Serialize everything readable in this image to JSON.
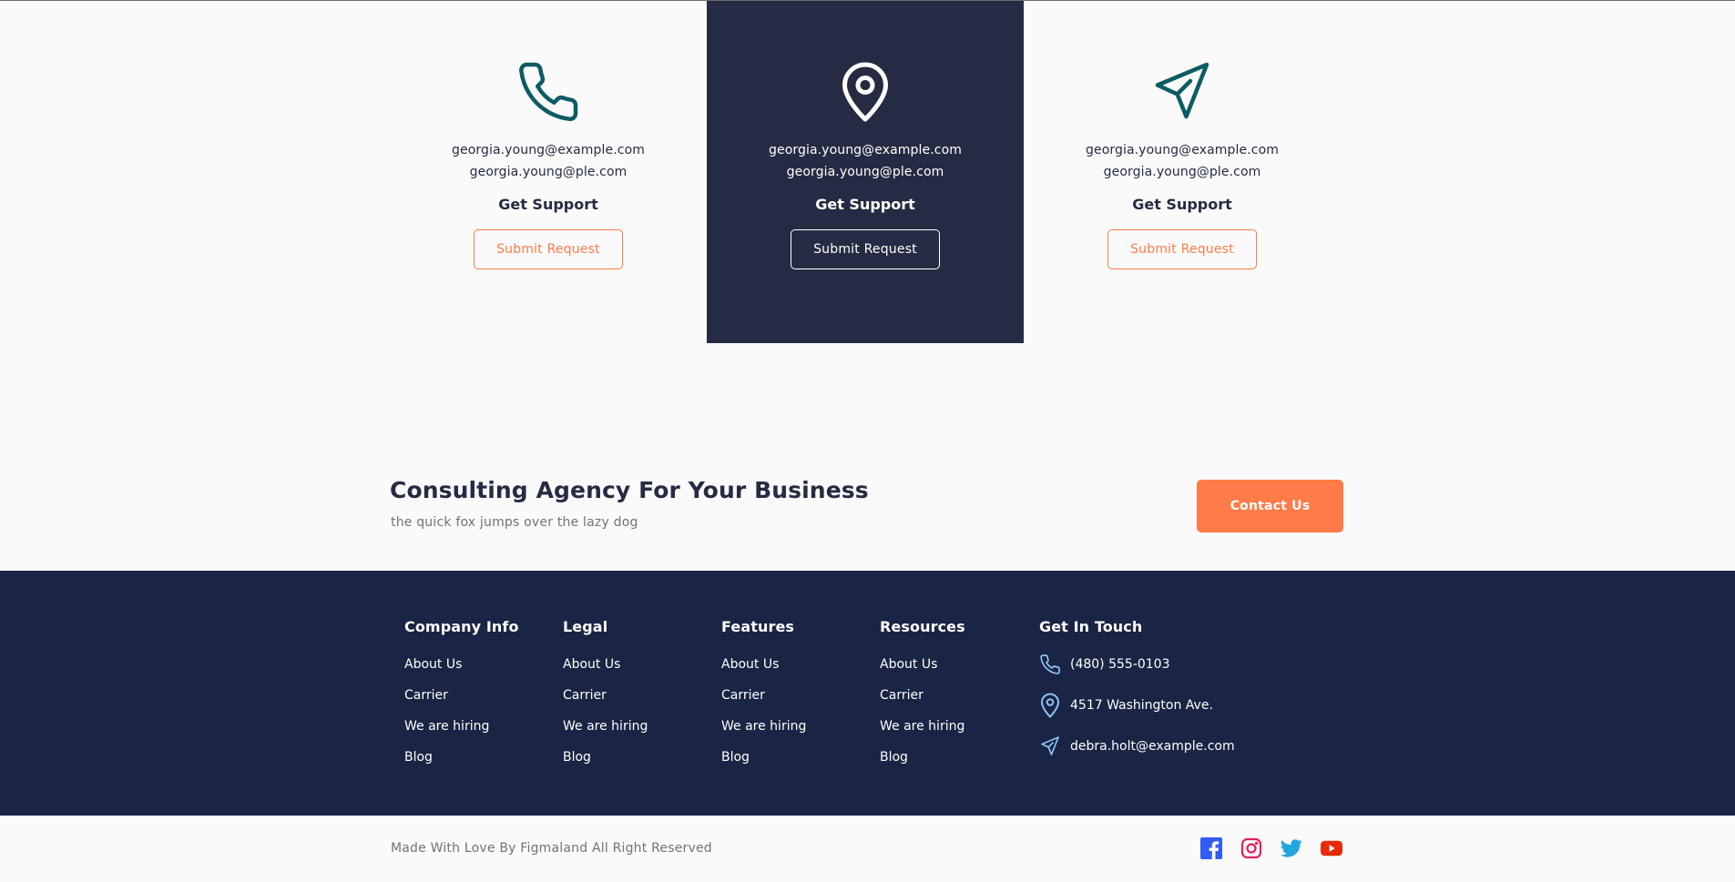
{
  "support_cards": [
    {
      "icon": "phone-icon",
      "email_primary": "georgia.young@example.com",
      "email_secondary": "georgia.young@ple.com",
      "label": "Get Support",
      "button_label": "Submit Request"
    },
    {
      "icon": "location-pin-icon",
      "email_primary": "georgia.young@example.com",
      "email_secondary": "georgia.young@ple.com",
      "label": "Get Support",
      "button_label": "Submit Request"
    },
    {
      "icon": "send-icon",
      "email_primary": "georgia.young@example.com",
      "email_secondary": "georgia.young@ple.com",
      "label": "Get Support",
      "button_label": "Submit Request"
    }
  ],
  "cta": {
    "title": "Consulting Agency For Your Business",
    "subtitle": "the quick fox jumps over the lazy dog",
    "button_label": "Contact Us"
  },
  "footer": {
    "columns": [
      {
        "title": "Company Info",
        "links": [
          "About Us",
          "Carrier",
          "We are hiring",
          "Blog"
        ]
      },
      {
        "title": "Legal",
        "links": [
          "About Us",
          "Carrier",
          "We are hiring",
          "Blog"
        ]
      },
      {
        "title": "Features",
        "links": [
          "About Us",
          "Carrier",
          "We are hiring",
          "Blog"
        ]
      },
      {
        "title": "Resources",
        "links": [
          "About Us",
          "Carrier",
          "We are hiring",
          "Blog"
        ]
      }
    ],
    "get_in_touch": {
      "title": "Get In Touch",
      "phone": "(480) 555-0103",
      "address": "4517 Washington Ave.",
      "email": "debra.holt@example.com"
    }
  },
  "bottom": {
    "copyright": "Made With Love By Figmaland All Right Reserved",
    "socials": [
      "facebook-icon",
      "instagram-icon",
      "twitter-icon",
      "youtube-icon"
    ]
  },
  "colors": {
    "accent": "#ff7b47",
    "dark_card": "#252b42",
    "footer_bg": "#1a2444",
    "icon_teal": "#0d5c63",
    "icon_light_blue": "#8ec2f2"
  }
}
